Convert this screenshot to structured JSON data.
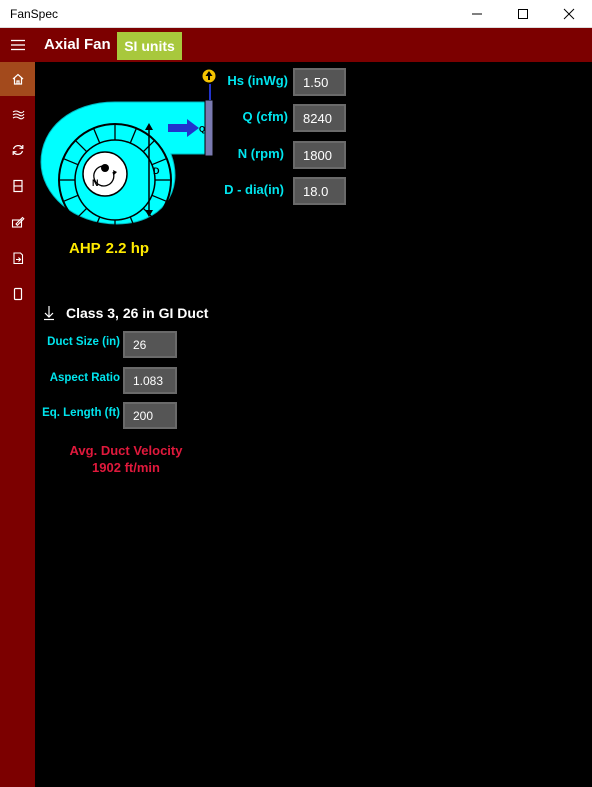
{
  "window": {
    "title": "FanSpec"
  },
  "header": {
    "title": "Axial Fan",
    "units_button": "SI units"
  },
  "nav": {
    "items": [
      {
        "name": "home",
        "icon": "home-icon",
        "active": true
      },
      {
        "name": "fan-curve",
        "icon": "waves-icon"
      },
      {
        "name": "convert",
        "icon": "refresh-icon"
      },
      {
        "name": "duct",
        "icon": "panel-icon"
      },
      {
        "name": "edit",
        "icon": "edit-icon"
      },
      {
        "name": "export",
        "icon": "export-icon"
      },
      {
        "name": "device",
        "icon": "device-icon"
      }
    ]
  },
  "fan": {
    "hs_label": "Hs (inWg)",
    "hs_value": "1.50",
    "q_label": "Q (cfm)",
    "q_value": "8240",
    "n_label": "N (rpm)",
    "n_value": "1800",
    "d_label": "D - dia(in)",
    "d_value": "18.0",
    "diagram_labels": {
      "q": "Q",
      "d": "D",
      "n": "N"
    },
    "ahp_label": "AHP",
    "ahp_value": "2.2 hp"
  },
  "duct": {
    "heading": "Class 3, 26 in GI Duct",
    "size_label": "Duct Size (in)",
    "size_value": "26",
    "aspect_label": "Aspect Ratio",
    "aspect_value": "1.083",
    "eq_label": "Eq. Length (ft)",
    "eq_value": "200",
    "velocity_label": "Avg. Duct Velocity",
    "velocity_value": "1902 ft/min"
  },
  "colors": {
    "header": "#7c0000",
    "accent": "#a8c83c",
    "label": "#00e5ee",
    "ahp": "#ffea00",
    "velocity": "#e0193c",
    "fan_body": "#00ffff"
  }
}
